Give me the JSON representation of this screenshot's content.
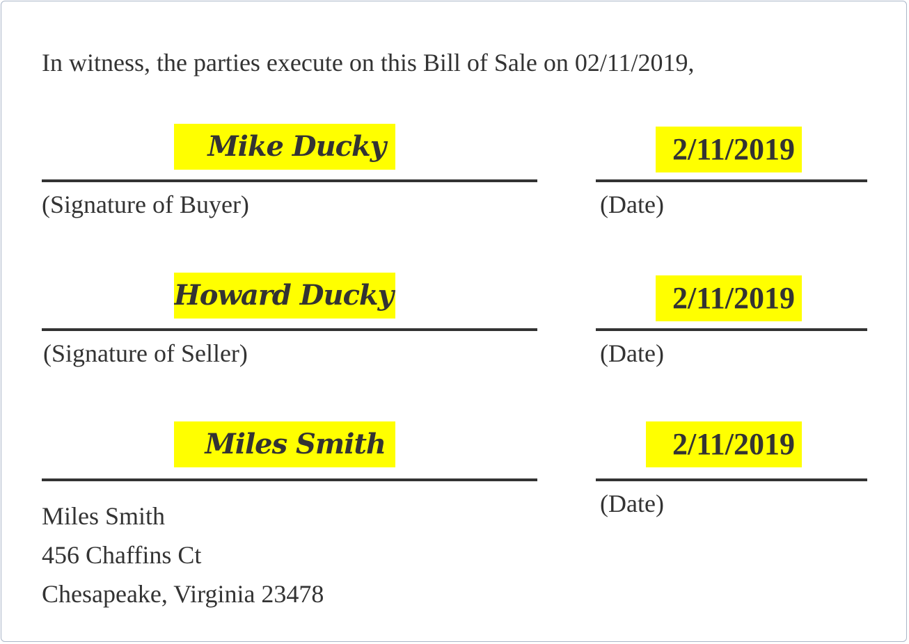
{
  "intro": "In witness, the parties execute on this Bill of Sale on 02/11/2019,",
  "signatures": [
    {
      "signature": "Mike Ducky",
      "label": "(Signature of Buyer)",
      "date": "2/11/2019",
      "date_label": "(Date)"
    },
    {
      "signature": "Howard Ducky",
      "label": "(Signature of Seller)",
      "date": "2/11/2019",
      "date_label": "(Date)"
    },
    {
      "signature": "Miles Smith",
      "date": "2/11/2019",
      "date_label": "(Date)"
    }
  ],
  "witness_address": {
    "name": "Miles Smith",
    "street": "456 Chaffins Ct",
    "city_state_zip": "Chesapeake, Virginia 23478"
  },
  "colors": {
    "highlight": "#ffff00",
    "text": "#333333",
    "border": "#aab6c8"
  }
}
